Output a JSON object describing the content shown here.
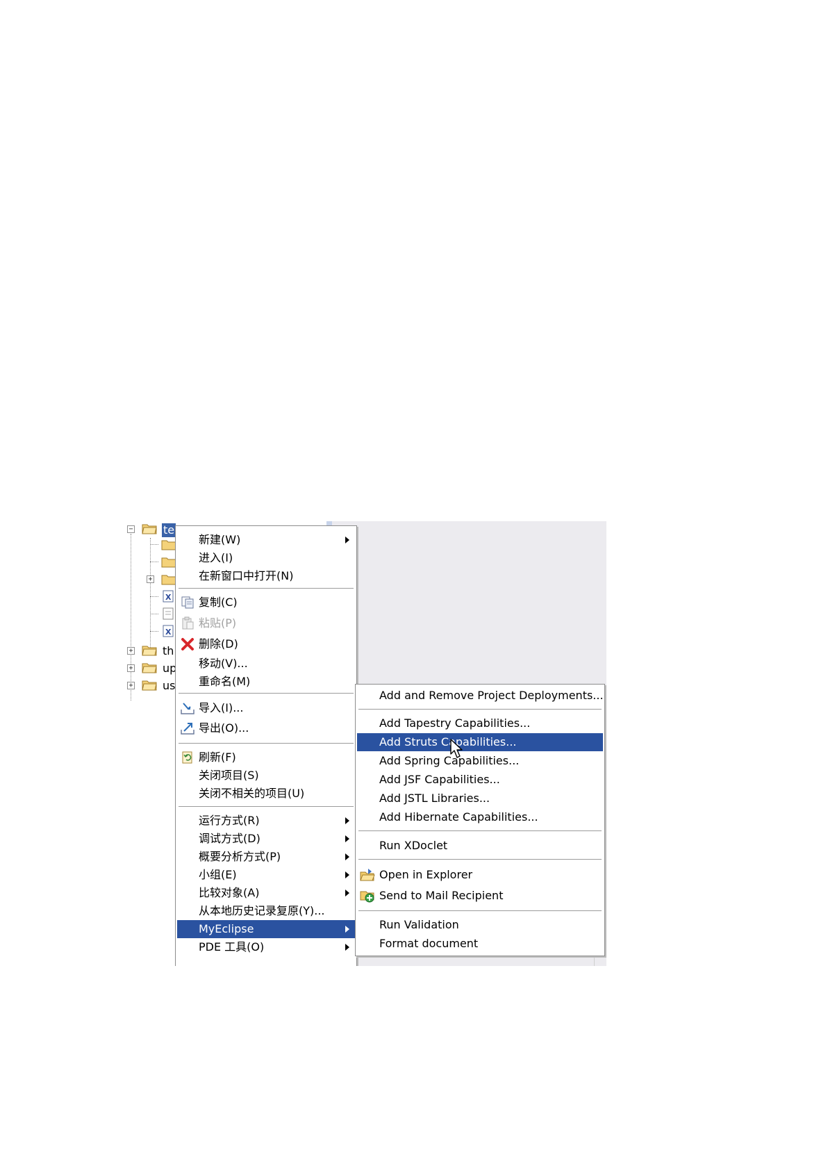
{
  "tree": {
    "root_label": "te",
    "items": [
      {
        "label": "th"
      },
      {
        "label": "up"
      },
      {
        "label": "us"
      }
    ]
  },
  "context_menu": {
    "items": [
      {
        "label": "新建(W)",
        "submenu": true
      },
      {
        "label": "进入(I)"
      },
      {
        "label": "在新窗口中打开(N)"
      },
      {
        "label": "复制(C)",
        "icon": "copy-icon"
      },
      {
        "label": "粘贴(P)",
        "icon": "paste-icon",
        "disabled": true
      },
      {
        "label": "删除(D)",
        "icon": "delete-icon"
      },
      {
        "label": "移动(V)..."
      },
      {
        "label": "重命名(M)"
      },
      {
        "label": "导入(I)...",
        "icon": "import-icon"
      },
      {
        "label": "导出(O)...",
        "icon": "export-icon"
      },
      {
        "label": "刷新(F)",
        "icon": "refresh-icon"
      },
      {
        "label": "关闭项目(S)"
      },
      {
        "label": "关闭不相关的项目(U)"
      },
      {
        "label": "运行方式(R)",
        "submenu": true
      },
      {
        "label": "调试方式(D)",
        "submenu": true
      },
      {
        "label": "概要分析方式(P)",
        "submenu": true
      },
      {
        "label": "小组(E)",
        "submenu": true
      },
      {
        "label": "比较对象(A)",
        "submenu": true
      },
      {
        "label": "从本地历史记录复原(Y)..."
      },
      {
        "label": "MyEclipse",
        "submenu": true,
        "highlighted": true
      },
      {
        "label": "PDE 工具(O)",
        "submenu": true
      }
    ]
  },
  "myeclipse_submenu": {
    "items": [
      {
        "label": "Add and Remove Project Deployments..."
      },
      {
        "label": "Add Tapestry Capabilities..."
      },
      {
        "label": "Add Struts Capabilities...",
        "highlighted": true
      },
      {
        "label": "Add Spring Capabilities..."
      },
      {
        "label": "Add JSF Capabilities..."
      },
      {
        "label": "Add JSTL Libraries..."
      },
      {
        "label": "Add Hibernate Capabilities..."
      },
      {
        "label": "Run XDoclet"
      },
      {
        "label": "Open in Explorer",
        "icon": "open-folder-icon"
      },
      {
        "label": "Send to Mail Recipient",
        "icon": "mail-recipient-icon"
      },
      {
        "label": "Run Validation"
      },
      {
        "label": "Format document"
      }
    ]
  },
  "colors": {
    "highlight": "#2a52a0",
    "editor_background": "#ecebef"
  }
}
